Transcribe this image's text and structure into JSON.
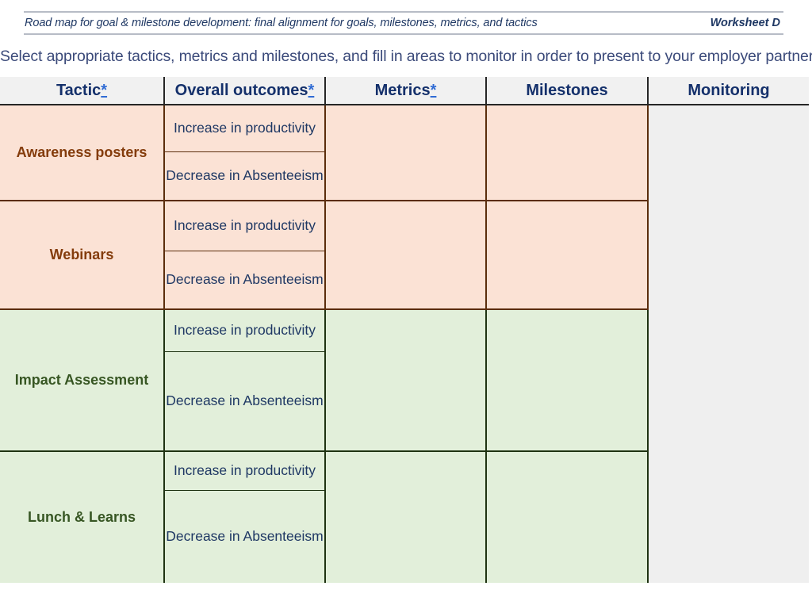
{
  "banner": {
    "title": "Road map for goal & milestone development: final alignment for goals, milestones, metrics, and tactics",
    "worksheet": "Worksheet D"
  },
  "instruction": "Select appropriate tactics, metrics and milestones, and fill in areas to monitor in order to present to your employer partner",
  "table": {
    "columns": [
      {
        "label": "Tactic",
        "marker": "*"
      },
      {
        "label": "Overall outcomes",
        "marker": "*"
      },
      {
        "label": "Metrics",
        "marker": "*"
      },
      {
        "label": "Milestones",
        "marker": ""
      },
      {
        "label": "Monitoring",
        "marker": ""
      }
    ],
    "rows": [
      {
        "tactic": "Awareness posters",
        "band": "peach",
        "outcomes": [
          "Increase in productivity",
          "Decrease in Absenteeism"
        ],
        "metrics": "",
        "milestones": "",
        "monitoring": ""
      },
      {
        "tactic": "Webinars",
        "band": "peach",
        "outcomes": [
          "Increase in productivity",
          "Decrease in Absenteeism"
        ],
        "metrics": "",
        "milestones": "",
        "monitoring": ""
      },
      {
        "tactic": "Impact Assessment",
        "band": "green",
        "outcomes": [
          "Increase in productivity",
          "Decrease in Absenteeism"
        ],
        "metrics": "",
        "milestones": "",
        "monitoring": ""
      },
      {
        "tactic": "Lunch & Learns",
        "band": "green",
        "outcomes": [
          "Increase in productivity",
          "Decrease in Absenteeism"
        ],
        "metrics": "",
        "milestones": "",
        "monitoring": ""
      }
    ]
  },
  "colors": {
    "peach_fill": "#fbe2d5",
    "green_fill": "#e2efda",
    "monitoring_fill": "#efefef",
    "header_fill": "#f1f1f1",
    "header_text": "#14306b",
    "peach_text": "#843c0c",
    "green_text": "#375623",
    "outcome_text": "#1f3864",
    "marker_blue": "#2f6bd4"
  }
}
